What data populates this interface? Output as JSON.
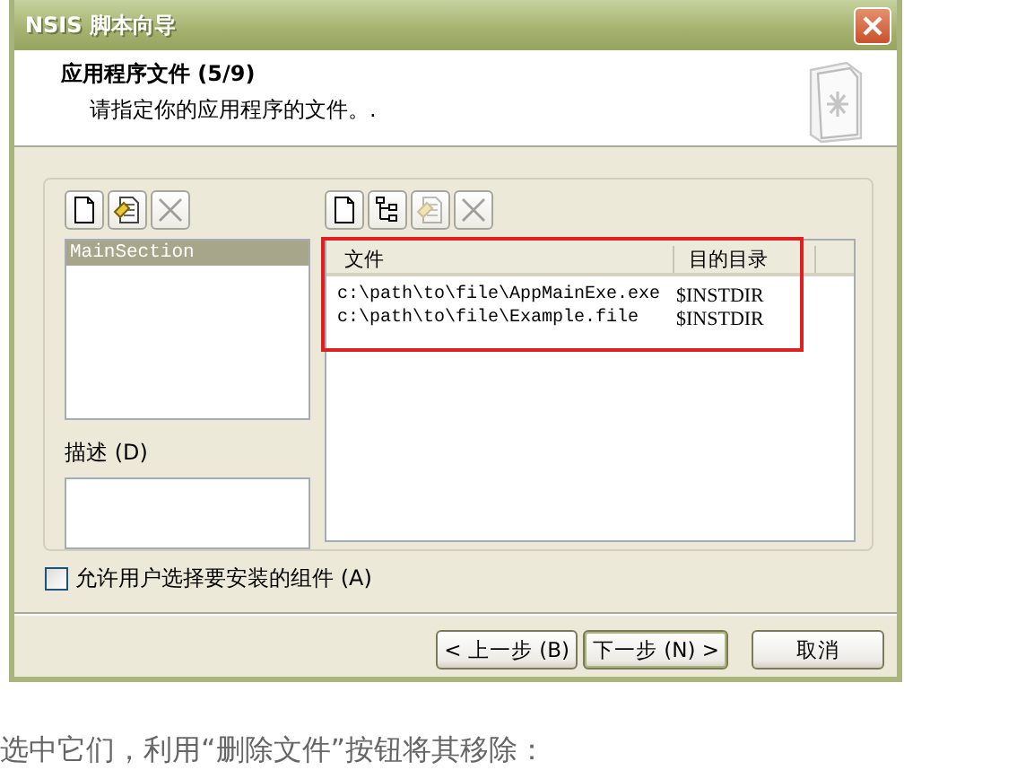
{
  "window": {
    "title": "NSIS 脚本向导"
  },
  "header": {
    "title": "应用程序文件 (5/9)",
    "subtitle": "请指定你的应用程序的文件。."
  },
  "sections_toolbar": [
    {
      "kind": "new",
      "disabled": false
    },
    {
      "kind": "edit",
      "disabled": false
    },
    {
      "kind": "delete",
      "disabled": true
    }
  ],
  "sections": [
    {
      "label": "MainSection",
      "selected": true
    }
  ],
  "description": {
    "label": "描述 (D)"
  },
  "files_toolbar": [
    {
      "kind": "new",
      "disabled": false
    },
    {
      "kind": "tree",
      "disabled": false
    },
    {
      "kind": "edit",
      "disabled": true
    },
    {
      "kind": "delete",
      "disabled": true
    }
  ],
  "files_table": {
    "annotated": true,
    "columns": [
      "文件",
      "目的目录"
    ],
    "rows": [
      [
        "c:\\path\\to\\file\\AppMainExe.exe",
        "$INSTDIR"
      ],
      [
        "c:\\path\\to\\file\\Example.file",
        "$INSTDIR"
      ]
    ]
  },
  "allow_select_components": {
    "label": "允许用户选择要安装的组件 (A)",
    "checked": false
  },
  "buttons": [
    {
      "label": "< 上一步 (B)",
      "default": false
    },
    {
      "label": "下一步 (N) >",
      "default": true
    },
    {
      "label": "取消",
      "default": false
    }
  ],
  "caption": "选中它们，利用“删除文件”按钮将其移除："
}
